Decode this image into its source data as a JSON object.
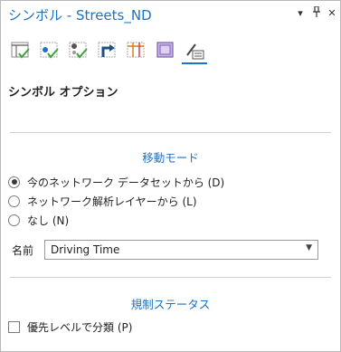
{
  "pane": {
    "title": "シンボル - Streets_ND",
    "menu_icon": "chevron-down-icon",
    "pin_icon": "pin-icon",
    "close_icon": "close-icon"
  },
  "toolbar": {
    "icons": [
      "stops-symbol-icon",
      "point-barrier-symbol-icon",
      "line-barrier-symbol-icon",
      "turn-symbol-icon",
      "restriction-symbol-icon",
      "polygon-barrier-symbol-icon",
      "symbol-options-icon"
    ],
    "active_index": 6
  },
  "section_title": "シンボル オプション",
  "travel_mode": {
    "heading": "移動モード",
    "options": [
      {
        "label": "今のネットワーク データセットから (D)",
        "checked": true
      },
      {
        "label": "ネットワーク解析レイヤーから (L)",
        "checked": false
      },
      {
        "label": "なし (N)",
        "checked": false
      }
    ],
    "name_label": "名前",
    "name_value": "Driving Time"
  },
  "restriction_status": {
    "heading": "規制ステータス",
    "checkbox_label": "優先レベルで分類 (P)",
    "checked": false
  },
  "colors": {
    "accent": "#1a73c7",
    "green": "#3aa53a",
    "orange": "#e07a1a"
  }
}
